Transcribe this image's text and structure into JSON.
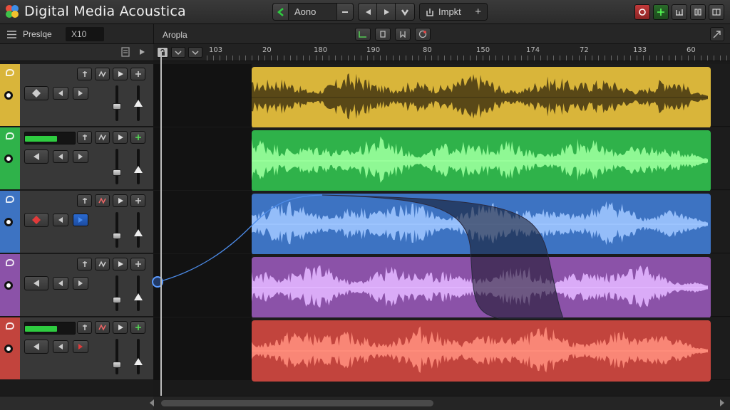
{
  "app": {
    "title": "Digital Media Acoustica"
  },
  "transport": {
    "field_label": "Aono",
    "import_label": "Impkt",
    "accent": "#2ecc40"
  },
  "subbar": {
    "preset_label": "Preslqe",
    "preset_value": "X10",
    "region_label": "Aropla"
  },
  "ruler": {
    "ticks": [
      "103",
      "20",
      "180",
      "190",
      "80",
      "150",
      "174",
      "72",
      "133",
      "60"
    ]
  },
  "tracks": [
    {
      "color": "#d9b53a",
      "wave_color": "#4a3c14",
      "show_meter": false,
      "meter_level": 0,
      "fader_level": 0.35,
      "record_color": "#d9b53a",
      "icon": "diamond-knob-icon"
    },
    {
      "color": "#2fb24a",
      "wave_color": "#9aff9c",
      "show_meter": true,
      "meter_level": 0.62,
      "fader_level": 0.25,
      "record_color": "#2fb24a",
      "icon": "left-arrow-knob-icon"
    },
    {
      "color": "#3d73c2",
      "wave_color": "#9dc5ff",
      "show_meter": false,
      "meter_level": 0,
      "fader_level": 0.25,
      "record_color": "#3d73c2",
      "icon": "red-diamond-knob-icon"
    },
    {
      "color": "#8b52a8",
      "wave_color": "#e2b5ff",
      "show_meter": false,
      "meter_level": 0,
      "fader_level": 0.2,
      "record_color": "#8b52a8",
      "icon": "left-arrow-knob-icon"
    },
    {
      "color": "#c2443d",
      "wave_color": "#ff8e7c",
      "show_meter": true,
      "meter_level": 0.62,
      "fader_level": 0.15,
      "record_color": "#c2443d",
      "icon": "left-arrow-knob-icon"
    }
  ]
}
